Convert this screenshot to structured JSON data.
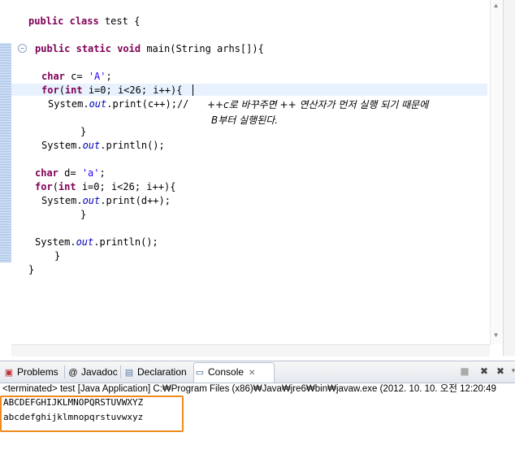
{
  "editor": {
    "lines": {
      "class_kw1": "public",
      "class_kw2": "class",
      "class_rest": " test {",
      "main_kw1": "public",
      "main_kw2": "static",
      "main_kw3": "void",
      "main_rest": " main(String arhs[]){",
      "l1_kw": "char",
      "l1_mid": " c= ",
      "l1_str": "'A'",
      "l1_end": ";",
      "l2_kw1": "for",
      "l2_a": "(",
      "l2_kw2": "int",
      "l2_rest": " i=0; i<26; i++){",
      "l3_a": "System.",
      "l3_it": "out",
      "l3_b": ".print(c++);//",
      "brace1": "}",
      "l4_a": "System.",
      "l4_it": "out",
      "l4_b": ".println();",
      "l5_kw": "char",
      "l5_mid": " d= ",
      "l5_str": "'a'",
      "l5_end": ";",
      "l6_kw1": "for",
      "l6_a": "(",
      "l6_kw2": "int",
      "l6_rest": " i=0; i<26; i++){",
      "l7_a": "System.",
      "l7_it": "out",
      "l7_b": ".print(d++);",
      "brace2": "}",
      "l8_a": "System.",
      "l8_it": "out",
      "l8_b": ".println();",
      "brace3": "}",
      "brace4": "}"
    },
    "comment_line1": "++c로 바꾸주면 ++ 연산자가 먼저 실행 되기 때문에",
    "comment_line2": "B부터 실행된다."
  },
  "tabs": {
    "problems": "Problems",
    "javadoc": "Javadoc",
    "declaration": "Declaration",
    "console": "Console"
  },
  "console": {
    "status": "<terminated> test [Java Application] C:₩Program Files (x86)₩Java₩jre6₩bin₩javaw.exe (2012. 10. 10. 오전 12:20:49",
    "output_line1": "ABCDEFGHIJKLMNOPQRSTUVWXYZ",
    "output_line2": "abcdefghijklmnopqrstuvwxyz"
  },
  "colors": {
    "keyword": "#7f0055",
    "string": "#2a00ff",
    "field": "#0000c0",
    "highlight_box": "#f08a1a"
  }
}
